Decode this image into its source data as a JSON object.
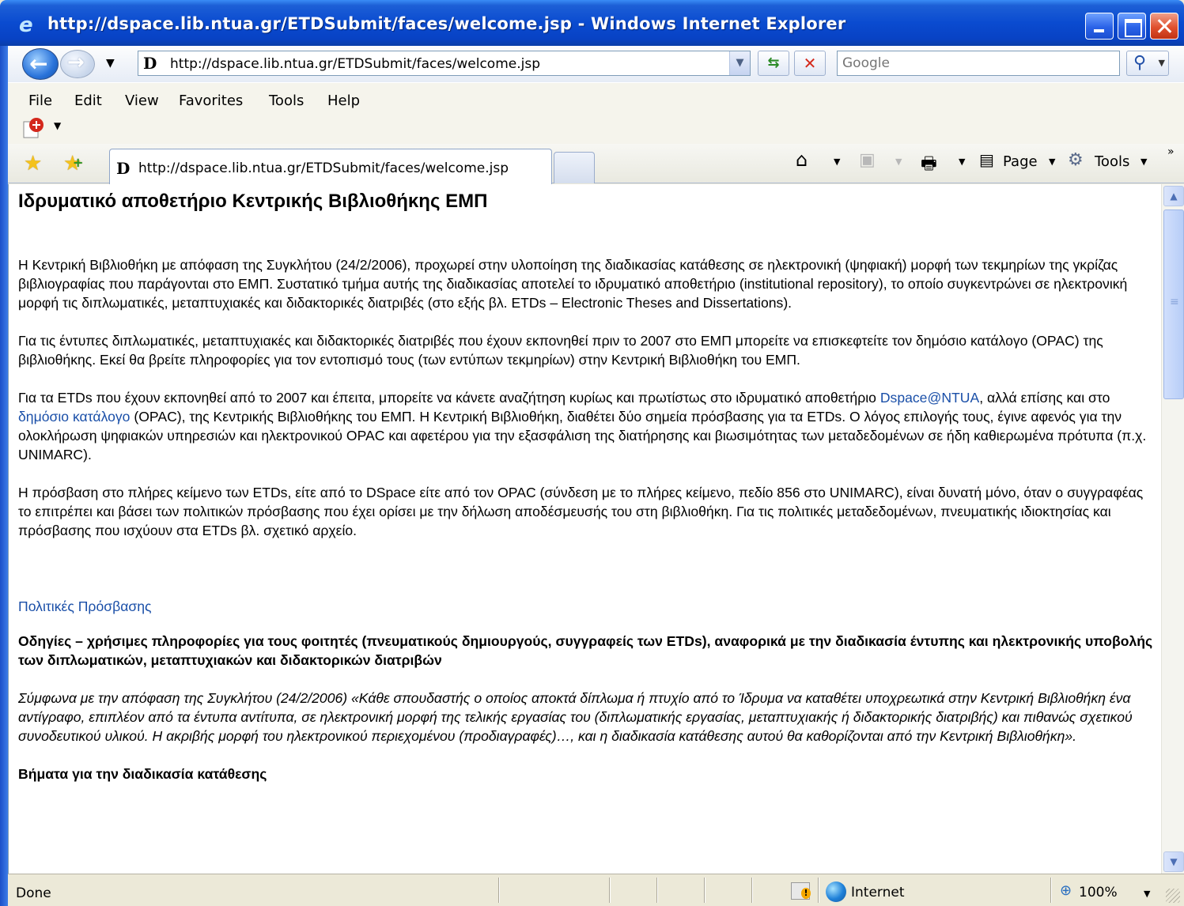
{
  "window": {
    "title": "http://dspace.lib.ntua.gr/ETDSubmit/faces/welcome.jsp - Windows Internet Explorer"
  },
  "address": {
    "url": "http://dspace.lib.ntua.gr/ETDSubmit/faces/welcome.jsp",
    "search_placeholder": "Google"
  },
  "menu": [
    "File",
    "Edit",
    "View",
    "Favorites",
    "Tools",
    "Help"
  ],
  "tab": {
    "label": "http://dspace.lib.ntua.gr/ETDSubmit/faces/welcome.jsp"
  },
  "commands": {
    "page": "Page",
    "tools": "Tools"
  },
  "page": {
    "heading": "Ιδρυματικό αποθετήριο Κεντρικής Βιβλιοθήκης ΕΜΠ",
    "p1": "Η Κεντρική Βιβλιοθήκη με απόφαση της Συγκλήτου (24/2/2006), προχωρεί στην υλοποίηση της διαδικασίας κατάθεσης σε ηλεκτρονική (ψηφιακή) μορφή των τεκμηρίων της γκρίζας βιβλιογραφίας που παράγονται στο ΕΜΠ. Συστατικό τμήμα αυτής της διαδικασίας αποτελεί το ιδρυματικό αποθετήριο (institutional repository), το οποίο συγκεντρώνει σε ηλεκτρονική μορφή τις διπλωματικές, μεταπτυχιακές και διδακτορικές διατριβές (στο εξής βλ. ETDs – Electronic Theses and Dissertations).",
    "p2": "Για τις έντυπες διπλωματικές, μεταπτυχιακές και διδακτορικές διατριβές που έχουν εκπονηθεί πριν το 2007 στο ΕΜΠ μπορείτε να επισκεφτείτε τον δημόσιο κατάλογο (OPAC) της βιβλιοθήκης. Εκεί θα βρείτε πληροφορίες για τον εντοπισμό τους (των εντύπων τεκμηρίων) στην Κεντρική Βιβλιοθήκη του ΕΜΠ.",
    "p3_a": "Για τα ETDs που έχουν εκπονηθεί από το 2007 και έπειτα, μπορείτε να κάνετε αναζήτηση κυρίως και πρωτίστως στο ιδρυματικό αποθετήριο ",
    "p3_link1": "Dspace@NTUA",
    "p3_b": ", αλλά επίσης και στο ",
    "p3_link2": "δημόσιο κατάλογο",
    "p3_c": " (OPAC), της Κεντρικής Βιβλιοθήκης του ΕΜΠ. Η Κεντρική Βιβλιοθήκη, διαθέτει δύο σημεία πρόσβασης για τα ETDs. Ο λόγος επιλογής τους, έγινε αφενός για την ολοκλήρωση ψηφιακών υπηρεσιών και ηλεκτρονικού OPAC και αφετέρου για την εξασφάλιση της διατήρησης και βιωσιμότητας των μεταδεδομένων σε ήδη καθιερωμένα πρότυπα (π.χ. UNIMARC).",
    "p4": "Η πρόσβαση στο πλήρες κείμενο των ETDs, είτε από το DSpace είτε από τον OPAC (σύνδεση με το πλήρες κείμενο, πεδίο 856 στο UNIMARC), είναι δυνατή μόνο, όταν ο συγγραφέας το επιτρέπει και βάσει των πολιτικών πρόσβασης που έχει ορίσει με την δήλωση αποδέσμευσής του στη βιβλιοθήκη. Για τις πολιτικές μεταδεδομένων, πνευματικής ιδιοκτησίας και πρόσβασης που ισχύουν στα ETDs βλ. σχετικό αρχείο.",
    "policies_link": "Πολιτικές Πρόσβασης",
    "guidelines": "Οδηγίες – χρήσιμες πληροφορίες για τους φοιτητές (πνευματικούς δημιουργούς, συγγραφείς των ETDs), αναφορικά με την διαδικασία έντυπης και ηλεκτρονικής υποβολής των διπλωματικών, μεταπτυχιακών και διδακτορικών διατριβών",
    "quote": "Σύμφωνα με την απόφαση της Συγκλήτου (24/2/2006) «Κάθε σπουδαστής ο οποίος αποκτά δίπλωμα ή πτυχίο από το Ίδρυμα να καταθέτει υποχρεωτικά στην Κεντρική Βιβλιοθήκη ένα αντίγραφο, επιπλέον από τα έντυπα αντίτυπα, σε ηλεκτρονική μορφή της τελικής εργασίας του (διπλωματικής εργασίας, μεταπτυχιακής ή διδακτορικής διατριβής) και πιθανώς σχετικού συνοδευτικού υλικού. Η ακριβής μορφή του ηλεκτρονικού περιεχομένου (προδιαγραφές)…, και η διαδικασία κατάθεσης αυτού θα καθορίζονται από την Κεντρική Βιβλιοθήκη».",
    "steps_heading": "Βήματα για την διαδικασία κατάθεσης"
  },
  "status": {
    "text": "Done",
    "zone": "Internet",
    "zoom": "100%"
  }
}
